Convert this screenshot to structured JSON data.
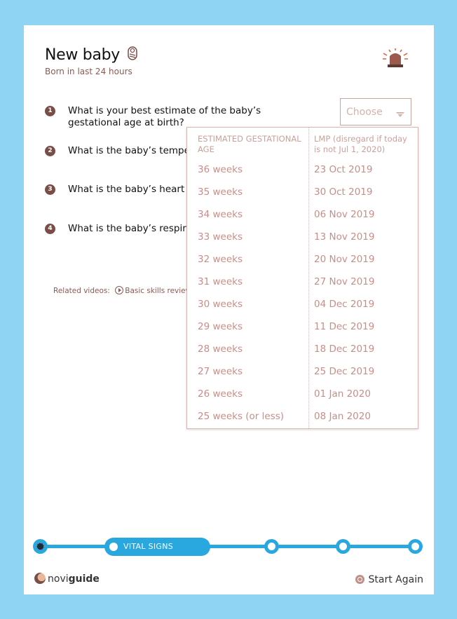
{
  "header": {
    "title": "New baby",
    "subtitle": "Born in last 24 hours",
    "baby_icon": "swaddled-baby-icon",
    "alarm_icon": "emergency-siren-icon"
  },
  "questions": [
    {
      "num": "1",
      "text": "What is your best estimate of the baby’s gestational age at birth?"
    },
    {
      "num": "2",
      "text": "What is the baby’s temper"
    },
    {
      "num": "3",
      "text": "What is the baby’s heart ra"
    },
    {
      "num": "4",
      "text": "What is the baby’s respira"
    }
  ],
  "select": {
    "placeholder": "Choose",
    "caret_icon": "chevron-down-icon"
  },
  "related": {
    "label": "Related videos:",
    "video": "Basic skills review"
  },
  "dropdown": {
    "col1_header": "ESTIMATED GESTATIONAL AGE",
    "col2_header": "LMP (disregard if today is not Jul 1, 2020)",
    "options": [
      {
        "weeks": "36 weeks",
        "lmp": "23 Oct 2019"
      },
      {
        "weeks": "35 weeks",
        "lmp": "30 Oct 2019"
      },
      {
        "weeks": "34 weeks",
        "lmp": "06 Nov 2019"
      },
      {
        "weeks": "33 weeks",
        "lmp": "13 Nov 2019"
      },
      {
        "weeks": "32 weeks",
        "lmp": "20 Nov 2019"
      },
      {
        "weeks": "31 weeks",
        "lmp": "27 Nov 2019"
      },
      {
        "weeks": "30 weeks",
        "lmp": "04 Dec 2019"
      },
      {
        "weeks": "29 weeks",
        "lmp": "11 Dec 2019"
      },
      {
        "weeks": "28 weeks",
        "lmp": "18 Dec 2019"
      },
      {
        "weeks": "27 weeks",
        "lmp": "25 Dec 2019"
      },
      {
        "weeks": "26 weeks",
        "lmp": "01 Jan 2020"
      },
      {
        "weeks": "25 weeks (or less)",
        "lmp": "08 Jan 2020"
      }
    ]
  },
  "progress": {
    "current_step_label": "VITAL SIGNS"
  },
  "footer": {
    "logo_prefix": "novi",
    "logo_suffix": "guide",
    "start_again": "Start Again"
  },
  "colors": {
    "background": "#8fd4f2",
    "accent": "#29a8e0",
    "brand_brown": "#7a4e48",
    "option_text": "#c48f88"
  }
}
